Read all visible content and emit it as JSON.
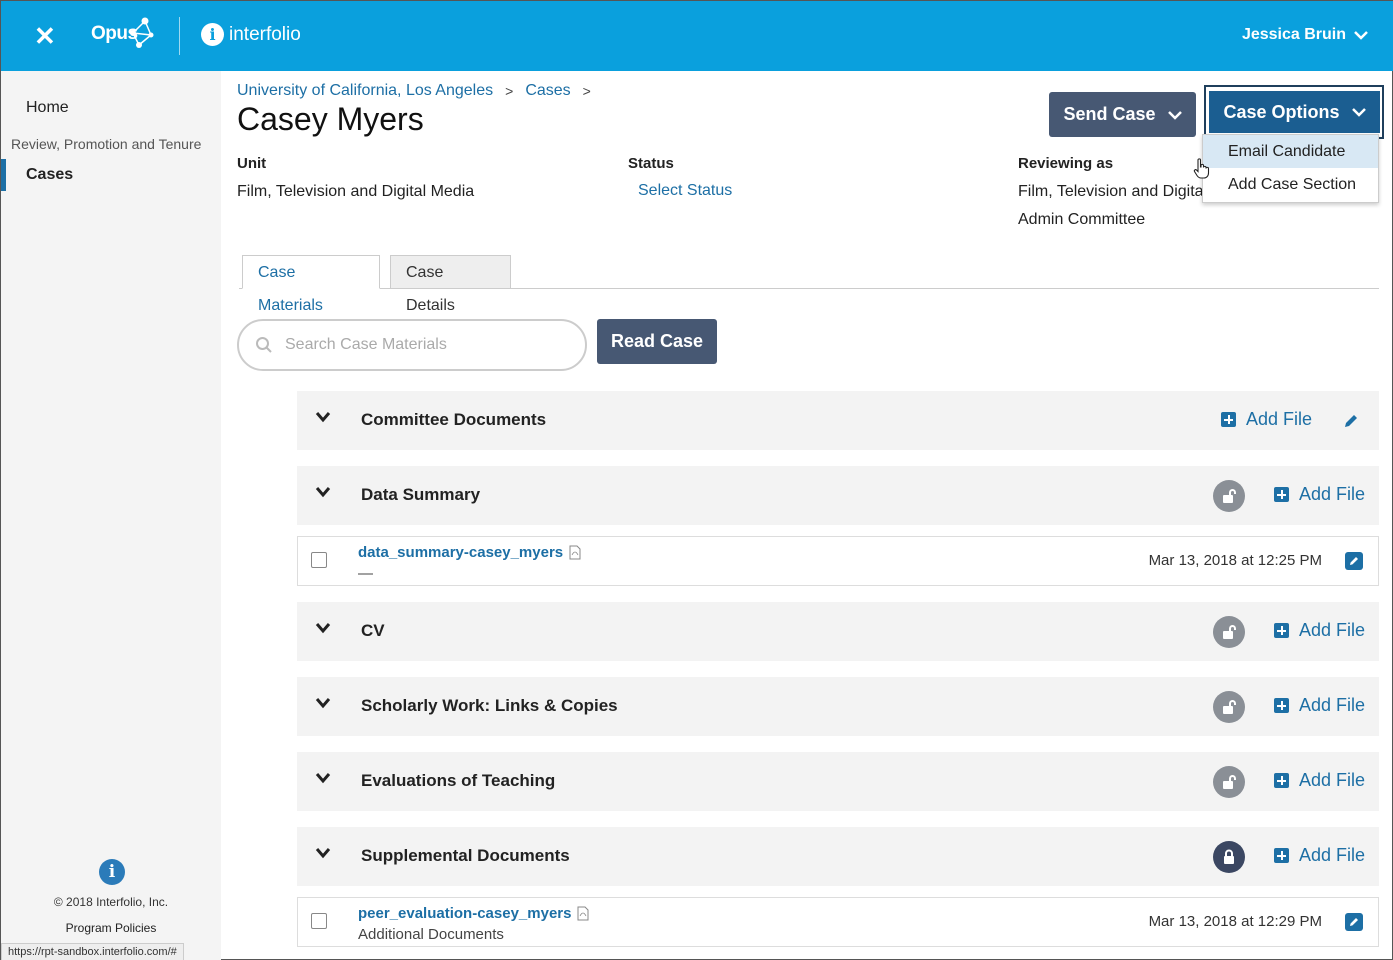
{
  "topbar": {
    "close_glyph": "✕",
    "app_name": "Opus",
    "brand_name": "interfolio",
    "brand_icon": "i",
    "user_name": "Jessica Bruin"
  },
  "sidebar": {
    "home": "Home",
    "section_label": "Review, Promotion and Tenure",
    "cases": "Cases",
    "info_icon": "i",
    "copyright": "© 2018 Interfolio, Inc.",
    "policies": "Program Policies"
  },
  "status_url": "https://rpt-sandbox.interfolio.com/#",
  "breadcrumb": {
    "items": [
      "University of California, Los Angeles",
      "Cases"
    ],
    "sep": ">"
  },
  "page_title": "Casey Myers",
  "meta": {
    "unit_label": "Unit",
    "unit_value": "Film, Television and Digital Media",
    "status_label": "Status",
    "status_value": "Select Status",
    "reviewing_label": "Reviewing as",
    "reviewing_value_1": "Film, Television and Digita",
    "reviewing_value_2": "Admin Committee"
  },
  "actions": {
    "send_case": "Send Case",
    "case_options": "Case Options",
    "dropdown": [
      "Email Candidate",
      "Add Case Section"
    ]
  },
  "tabs": [
    "Case Materials",
    "Case Details"
  ],
  "search": {
    "placeholder": "Search Case Materials"
  },
  "read_case": "Read Case",
  "add_file_label": "Add File",
  "sections": [
    {
      "title": "Committee Documents"
    },
    {
      "title": "Data Summary"
    },
    {
      "title": "CV"
    },
    {
      "title": "Scholarly Work: Links & Copies"
    },
    {
      "title": "Evaluations of Teaching"
    },
    {
      "title": "Supplemental Documents"
    }
  ],
  "files": [
    {
      "name": "data_summary-casey_myers",
      "sub": "—",
      "date": "Mar 13, 2018 at 12:25 PM"
    },
    {
      "name": "peer_evaluation-casey_myers",
      "sub": "Additional Documents",
      "date": "Mar 13, 2018 at 12:29 PM"
    }
  ],
  "colors": {
    "topbar": "#0aa0dd",
    "link": "#1d6fa5",
    "primary_button": "#475873",
    "options_button": "#1b5e91"
  }
}
